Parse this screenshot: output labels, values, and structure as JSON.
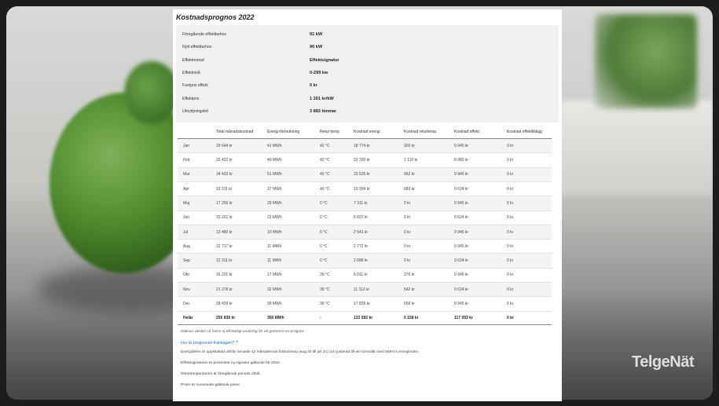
{
  "title": "Kostnadsprognos 2022",
  "info": [
    {
      "label": "Föregående effektbehov",
      "value": "91 kW"
    },
    {
      "label": "Nytt effektbehov",
      "value": "90 kW"
    },
    {
      "label": "Effektmetod",
      "value": "Effektsignatur"
    },
    {
      "label": "Effektnivå",
      "value": "0-299 kw"
    },
    {
      "label": "Fastpris effekt",
      "value": "0 kr"
    },
    {
      "label": "Effektpris",
      "value": "1 301 kr/kW"
    },
    {
      "label": "Utnyttjningstid",
      "value": "3 882 timmar"
    }
  ],
  "table": {
    "headers": [
      "",
      "Total månadskostnad",
      "Energi-förbrukning",
      "Retur-temp",
      "Kostnad energi",
      "Kostnad returtemp",
      "Kostnad effekt",
      "Kostnad effekttillägg"
    ],
    "rows": [
      [
        "Jan",
        "29 644 kr",
        "41 MWh",
        "42 °C",
        "18 774 kr",
        "926 kr",
        "9 945 kr",
        "0 kr"
      ],
      [
        "Feb",
        "32 422 kr",
        "49 MWh",
        "42 °C",
        "22 330 kr",
        "1 110 kr",
        "8 982 kr",
        "0 kr"
      ],
      [
        "Mar",
        "34 433 kr",
        "51 MWh",
        "40 °C",
        "23 526 kr",
        "962 kr",
        "9 945 kr",
        "0 kr"
      ],
      [
        "Apr",
        "23 311 kr",
        "37 MWh",
        "40 °C",
        "13 004 kr",
        "683 kr",
        "9 624 kr",
        "0 kr"
      ],
      [
        "Maj",
        "17 256 kr",
        "29 MWh",
        "0 °C",
        "7 311 kr",
        "0 kr",
        "9 945 kr",
        "0 kr"
      ],
      [
        "Jun",
        "15 321 kr",
        "23 MWh",
        "0 °C",
        "5 697 kr",
        "0 kr",
        "9 624 kr",
        "0 kr"
      ],
      [
        "Jul",
        "12 486 kr",
        "10 MWh",
        "0 °C",
        "2 541 kr",
        "0 kr",
        "9 945 kr",
        "0 kr"
      ],
      [
        "Aug",
        "12 717 kr",
        "11 MWh",
        "0 °C",
        "2 772 kr",
        "0 kr",
        "9 945 kr",
        "0 kr"
      ],
      [
        "Sep",
        "12 311 kr",
        "11 MWh",
        "0 °C",
        "2 688 kr",
        "0 kr",
        "9 624 kr",
        "0 kr"
      ],
      [
        "Okt",
        "16 231 kr",
        "17 MWh",
        "39 °C",
        "6 011 kr",
        "276 kr",
        "9 945 kr",
        "0 kr"
      ],
      [
        "Nov",
        "21 278 kr",
        "32 MWh",
        "39 °C",
        "11 112 kr",
        "542 kr",
        "9 624 kr",
        "0 kr"
      ],
      [
        "Dec",
        "28 429 kr",
        "39 MWh",
        "39 °C",
        "17 826 kr",
        "659 kr",
        "9 945 kr",
        "0 kr"
      ]
    ],
    "total": [
      "Helår",
      "255 839 kr",
      "350 MWh",
      "-",
      "133 592 kr",
      "5 158 kr",
      "117 093 kr",
      "0 kr"
    ]
  },
  "note": "Saknas värden så fanns ej tillräckligt underlag för att generera en prognos",
  "how_link": "Hur är prognosen framtagen?",
  "paragraphs": [
    "Energidelen är uppskattad utifrån senaste 12 månadernas förbrukning (aug 20 till juli 21) och justerad till ett normalår med SMHI:s energiindex.",
    "Effektsignaturen är preliminär ny signatur gällande för 2022",
    "Returtemperaturen är föregående periods utfall.",
    "Priser är nuvarande gällande priser."
  ],
  "brand": "TelgeNät"
}
